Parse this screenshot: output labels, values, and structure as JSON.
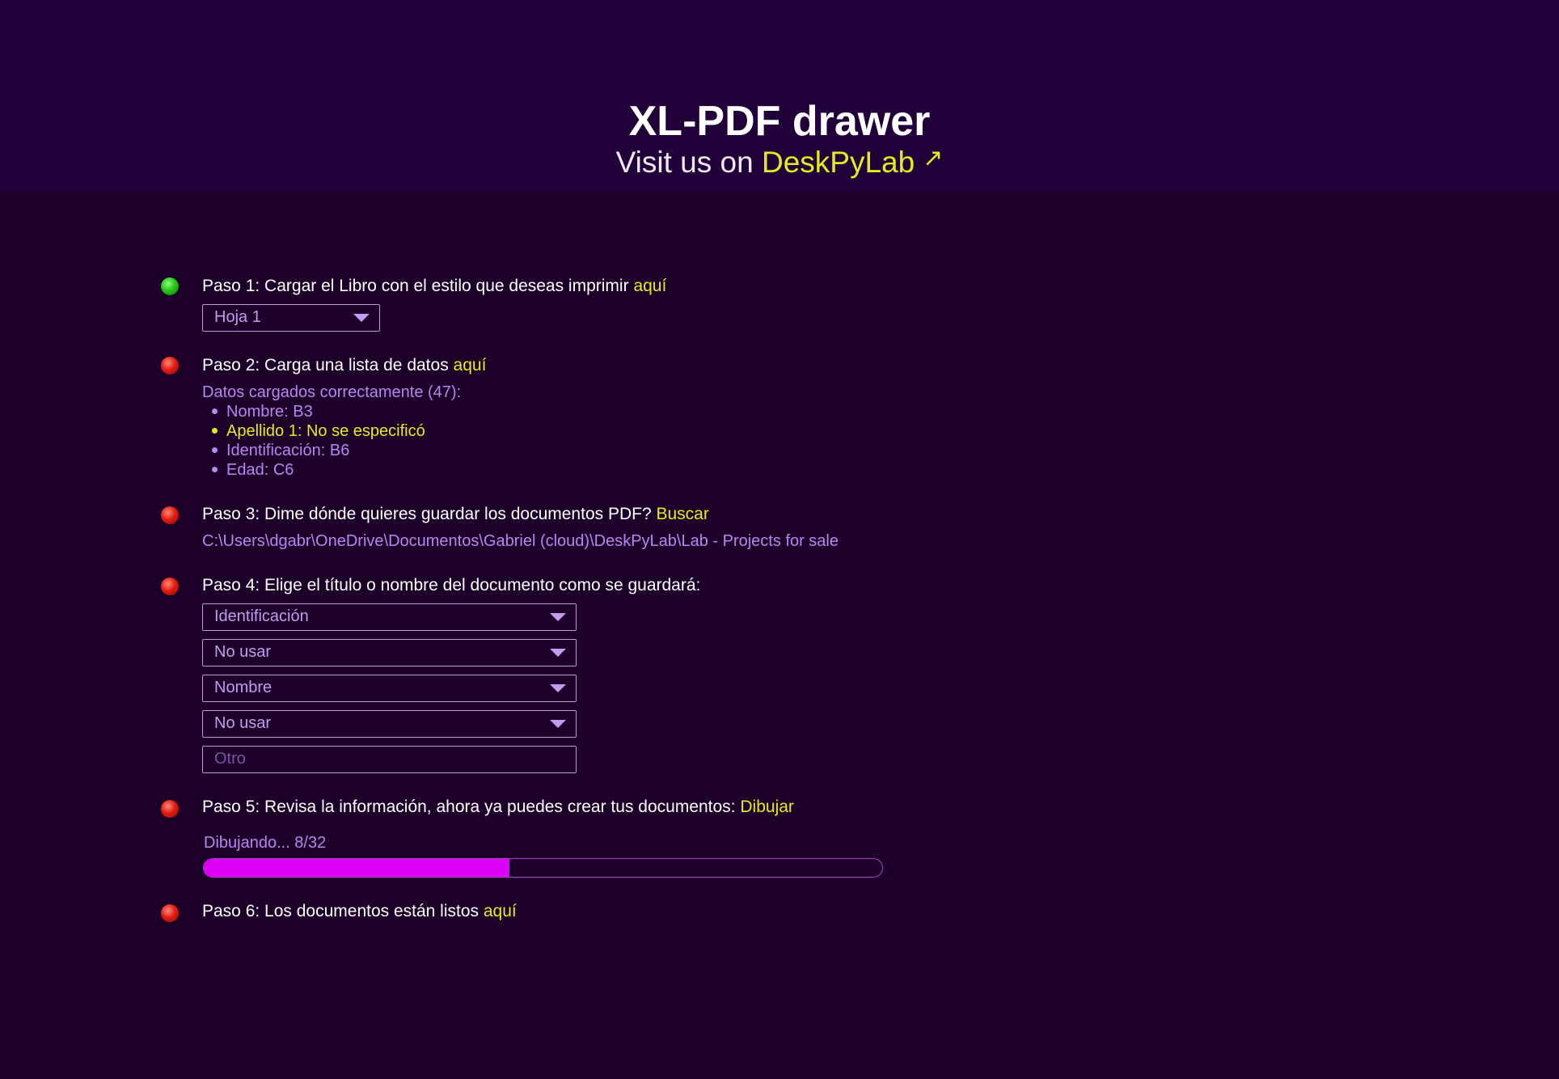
{
  "header": {
    "title": "XL-PDF drawer",
    "subtitle_prefix": "Visit us on",
    "subtitle_link": "DeskPyLab",
    "external_icon": "arrow-up-right-icon"
  },
  "colors": {
    "background": "#1c0029",
    "header_background": "#21003a",
    "accent_yellow": "#e4ec1c",
    "accent_lilac": "#b985ef",
    "progress_fill": "#de00f4",
    "status_done": "#26c41a",
    "status_pending": "#e41d12"
  },
  "steps": {
    "step1": {
      "status": "done",
      "text": "Paso 1: Cargar el Libro con el estilo que deseas imprimir",
      "action": "aquí",
      "sheet_select": "Hoja 1"
    },
    "step2": {
      "status": "pending",
      "text": "Paso 2: Carga una lista de datos",
      "action": "aquí",
      "loaded_message": "Datos cargados correctamente (47):",
      "fields": [
        "Nombre: B3",
        "Apellido 1: No se especificó",
        "Identificación: B6",
        "Edad: C6"
      ]
    },
    "step3": {
      "status": "pending",
      "text": "Paso 3: Dime dónde quieres guardar los documentos PDF?",
      "action": "Buscar",
      "path": "C:\\Users\\dgabr\\OneDrive\\Documentos\\Gabriel (cloud)\\DeskPyLab\\Lab - Projects for sale"
    },
    "step4": {
      "status": "pending",
      "text": "Paso 4: Elige el título o nombre del documento como se guardará:",
      "selects": [
        "Identificación",
        "No usar",
        "Nombre",
        "No usar"
      ],
      "other_placeholder": "Otro"
    },
    "step5": {
      "status": "pending",
      "text": "Paso 5: Revisa la información, ahora ya puedes crear tus documentos:",
      "action": "Dibujar",
      "progress_text": "Dibujando... 8/32",
      "progress_fraction": 0.45
    },
    "step6": {
      "status": "pending",
      "text": "Paso 6: Los documentos están listos",
      "action": "aquí"
    }
  }
}
